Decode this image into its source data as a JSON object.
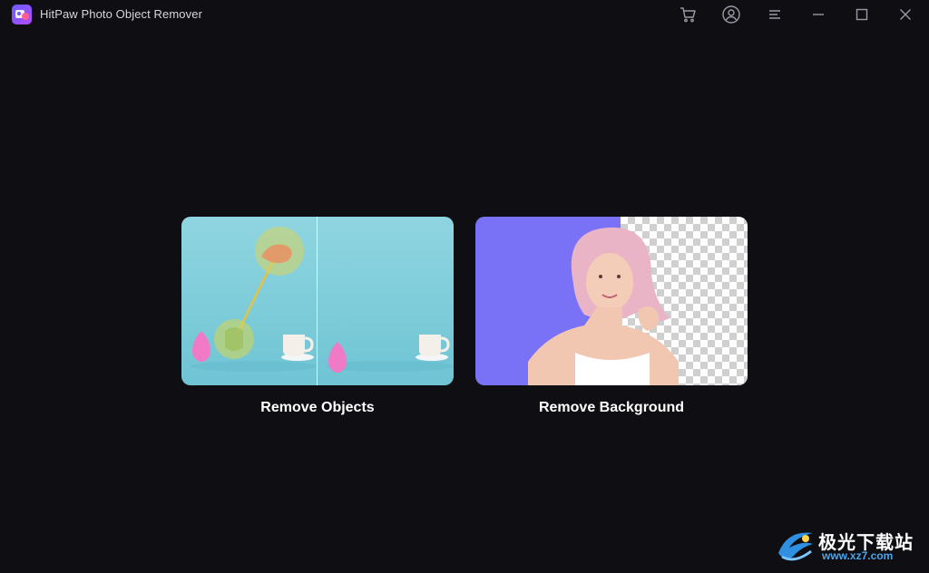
{
  "window": {
    "title": "HitPaw Photo Object Remover",
    "icons": [
      "cart-icon",
      "account-icon",
      "menu-icon",
      "minimize-icon",
      "maximize-icon",
      "close-icon"
    ]
  },
  "cards": [
    {
      "label": "Remove Objects"
    },
    {
      "label": "Remove Background"
    }
  ],
  "watermark": {
    "title": "极光下载站",
    "url": "www.xz7.com"
  },
  "colors": {
    "background": "#0e0e13",
    "accent_purple": "#7a72f6",
    "watermark_blue": "#49a6ea"
  }
}
